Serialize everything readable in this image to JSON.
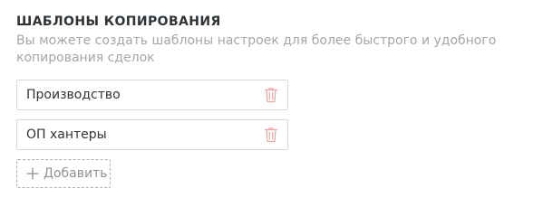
{
  "section": {
    "title": "ШАБЛОНЫ КОПИРОВАНИЯ",
    "description": "Вы можете создать шаблоны настроек для более быстрого и удобного копирования сделок"
  },
  "templates": [
    {
      "name": "Производство",
      "delete_icon": "trash-icon"
    },
    {
      "name": "ОП хантеры",
      "delete_icon": "trash-icon"
    }
  ],
  "add_button": {
    "label": "Добавить",
    "icon": "plus-icon"
  },
  "colors": {
    "text": "#2f3438",
    "muted": "#a2a7ab",
    "border": "#d7dadd",
    "delete_icon": "#f0a3a3",
    "add_text": "#8c9297"
  }
}
